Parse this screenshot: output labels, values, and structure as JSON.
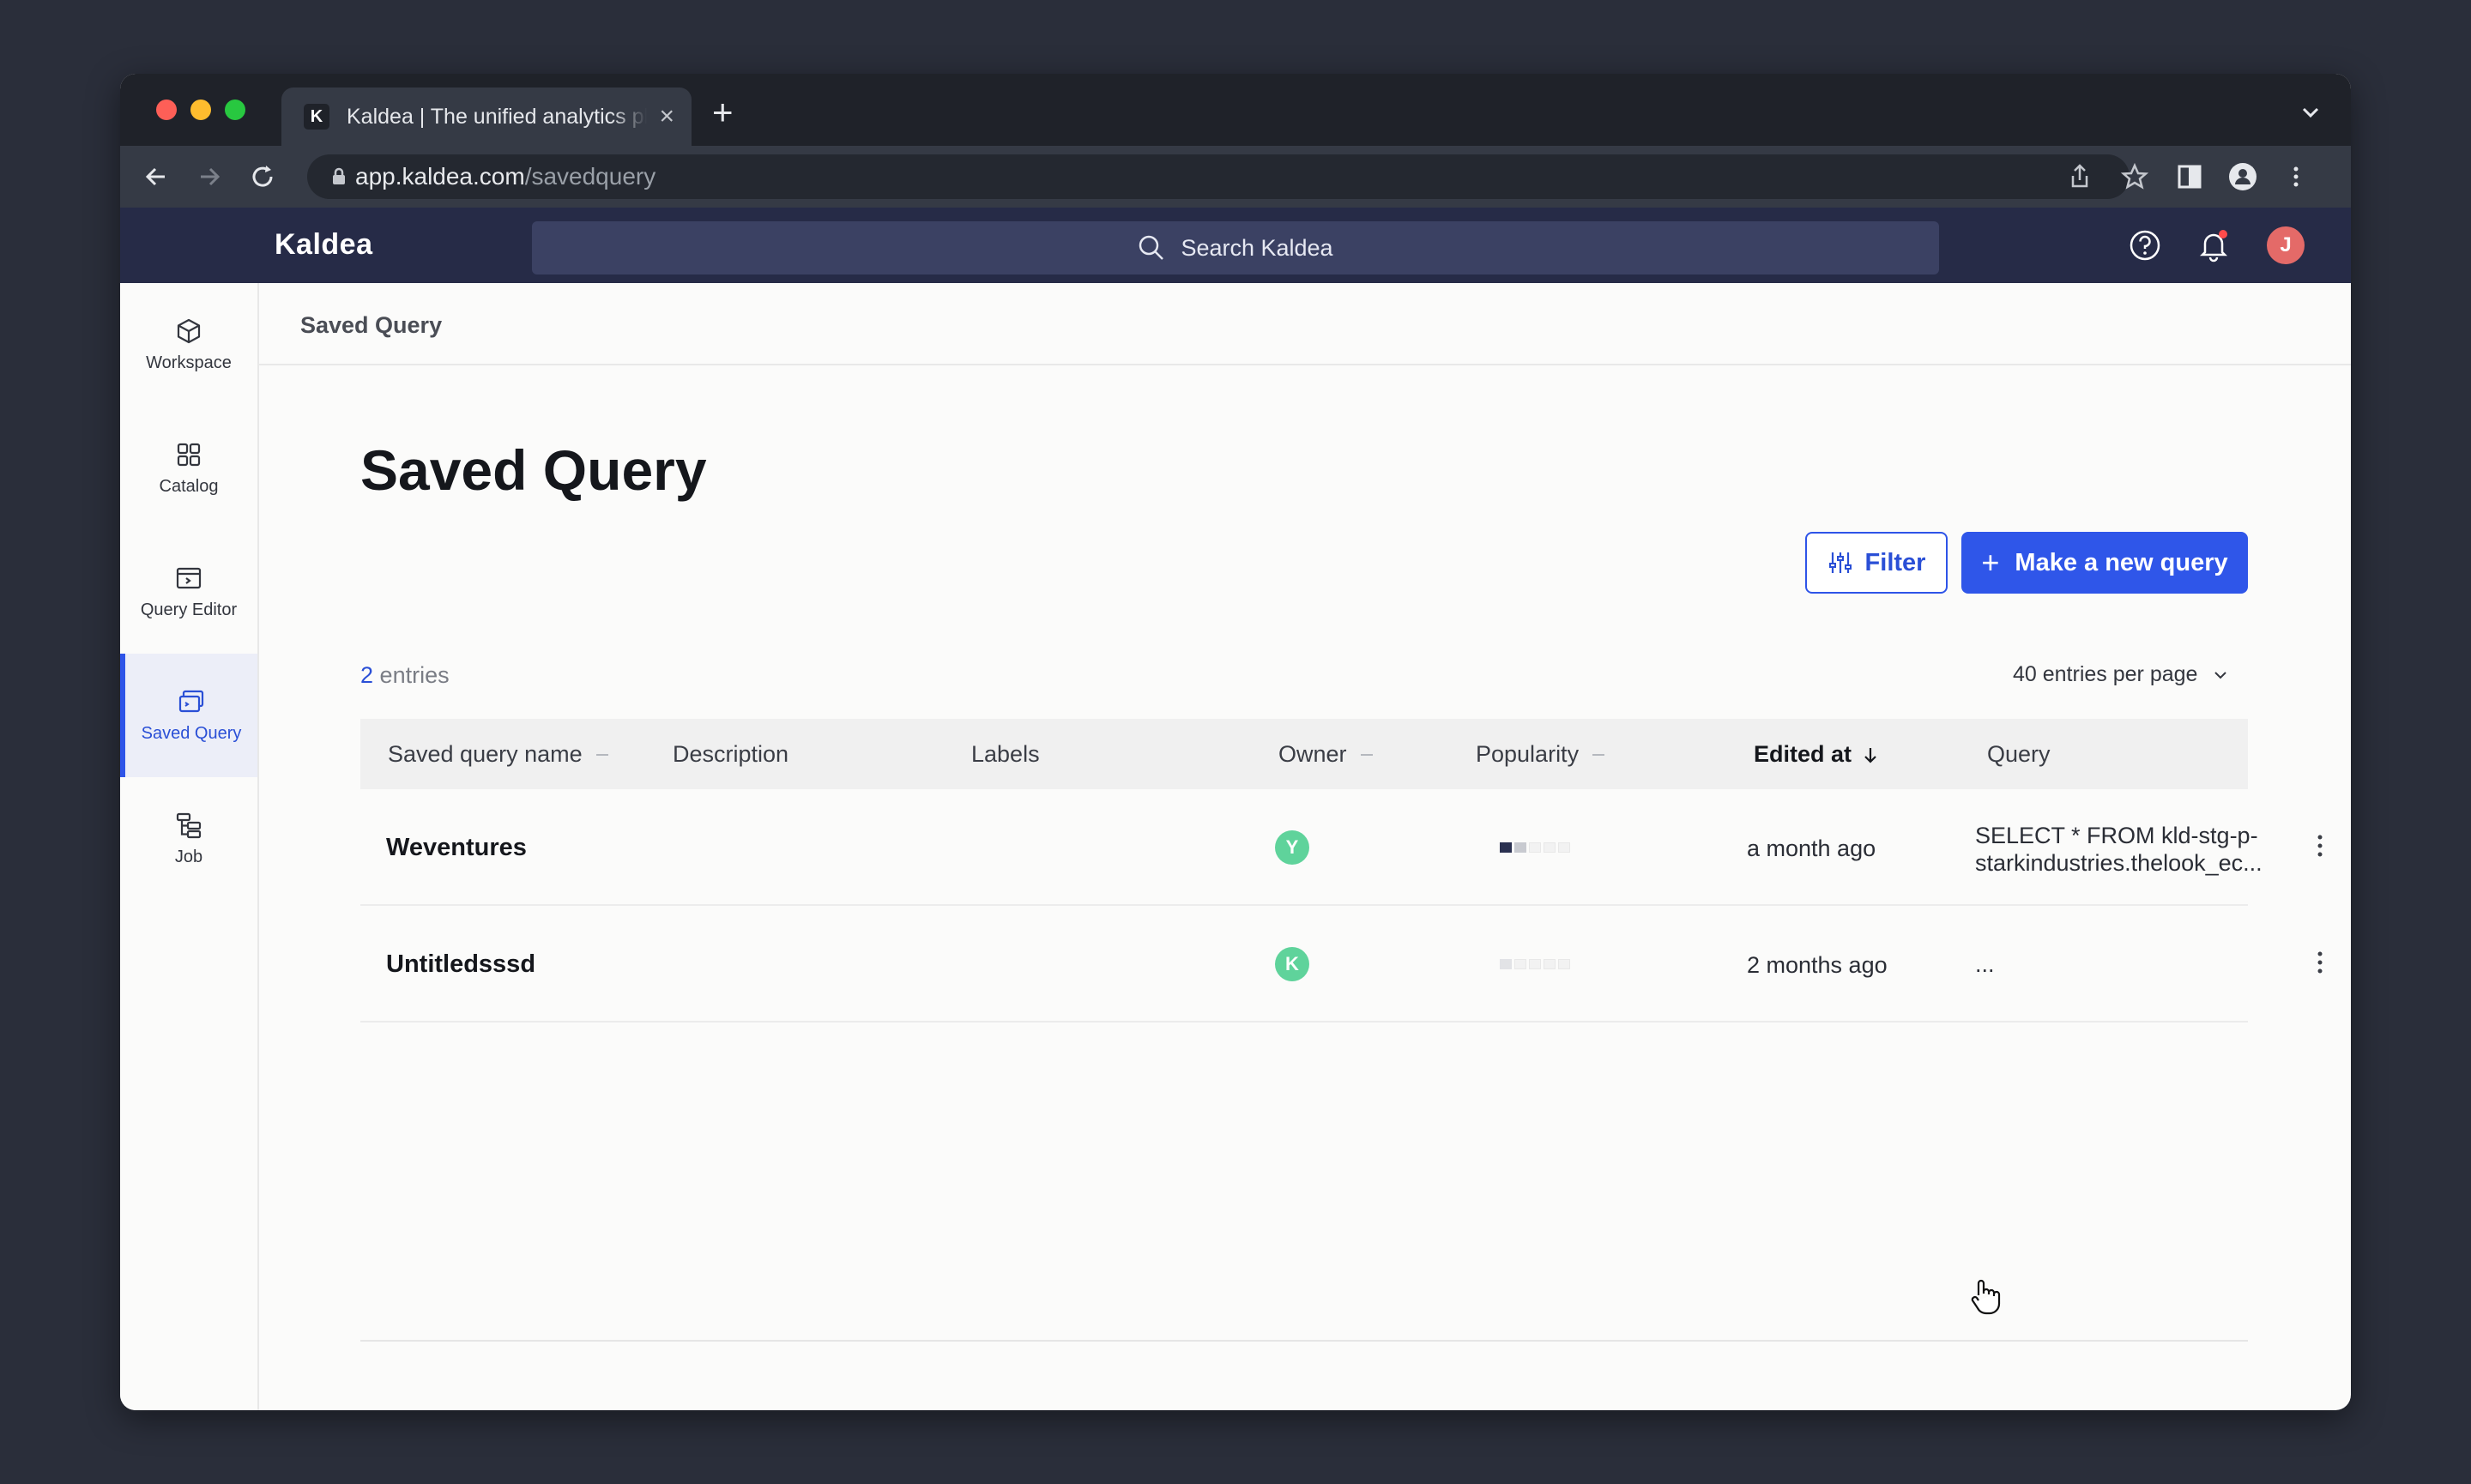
{
  "browser": {
    "tab_title": "Kaldea | The unified analytics platform",
    "tab_favicon": "K",
    "url_host": "app.kaldea.com",
    "url_path": "/savedquery"
  },
  "app": {
    "logo": "Kaldea",
    "search_placeholder": "Search Kaldea",
    "avatar_initial": "J"
  },
  "sidebar": {
    "items": [
      {
        "label": "Workspace",
        "icon": "cube-icon"
      },
      {
        "label": "Catalog",
        "icon": "grid-icon"
      },
      {
        "label": "Query Editor",
        "icon": "editor-icon"
      },
      {
        "label": "Saved Query",
        "icon": "saved-query-icon",
        "active": true
      },
      {
        "label": "Job",
        "icon": "job-icon"
      }
    ]
  },
  "breadcrumb": "Saved Query",
  "page_title": "Saved Query",
  "buttons": {
    "filter": "Filter",
    "new_query": "Make a new query"
  },
  "entries": {
    "count": "2",
    "label": "entries",
    "per_page": "40 entries per page"
  },
  "table": {
    "columns": {
      "name": "Saved query name",
      "description": "Description",
      "labels": "Labels",
      "owner": "Owner",
      "popularity": "Popularity",
      "edited_at": "Edited at",
      "query": "Query"
    },
    "rows": [
      {
        "name": "Weventures",
        "owner_initial": "Y",
        "popularity": 2,
        "edited_at": "a month ago",
        "query": "SELECT * FROM kld-stg-p-starkindustries.thelook_ec..."
      },
      {
        "name": "Untitledsssd",
        "owner_initial": "K",
        "popularity": 1,
        "edited_at": "2 months ago",
        "query": "..."
      }
    ]
  },
  "colors": {
    "accent": "#2f56e9",
    "header_bg": "#262b47",
    "owner_badge": "#5fd39b",
    "avatar": "#e46a68"
  }
}
